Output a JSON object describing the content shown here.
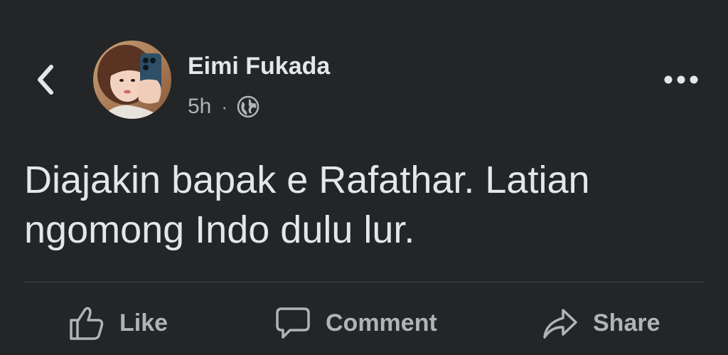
{
  "post": {
    "author_name": "Eimi Fukada",
    "timestamp": "5h",
    "separator": "·",
    "privacy_icon": "globe-icon",
    "text_lines": [
      "Diajakin bapak e Rafathar. Latian",
      "ngomong Indo dulu lur."
    ]
  },
  "header": {
    "back_icon": "chevron-left-icon",
    "more_icon": "more-horizontal-icon"
  },
  "actions": {
    "like_label": "Like",
    "comment_label": "Comment",
    "share_label": "Share",
    "like_icon": "thumbs-up-icon",
    "comment_icon": "comment-bubble-icon",
    "share_icon": "share-arrow-icon"
  },
  "colors": {
    "background": "#242526",
    "primary_text": "#e4e6eb",
    "secondary_text": "#b0b3b8",
    "divider": "#3e4042"
  }
}
